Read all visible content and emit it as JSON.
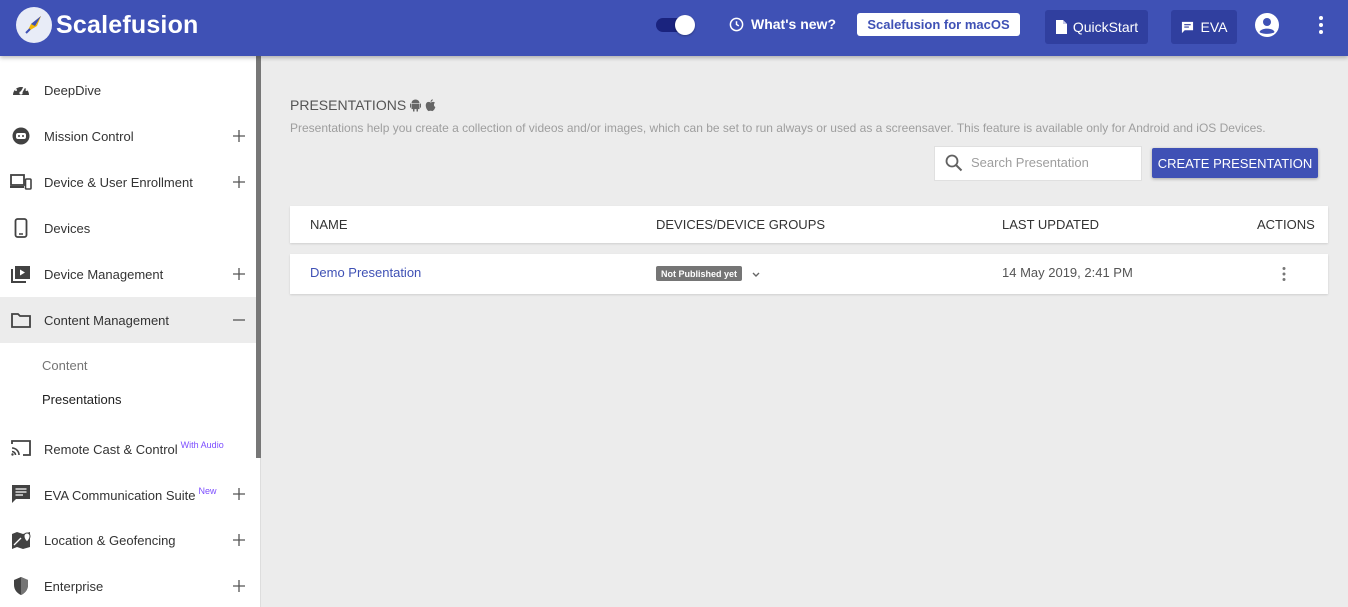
{
  "header": {
    "brand": "Scalefusion",
    "whats_new": "What's new?",
    "mac_button": "Scalefusion for macOS",
    "quickstart": "QuickStart",
    "eva": "EVA",
    "icons": [
      "rocket-logo",
      "toggle-switch",
      "clock-icon",
      "document-icon",
      "chat-icon",
      "account-circle-icon",
      "more-vert-icon"
    ]
  },
  "sidebar": {
    "items": [
      {
        "label": "DeepDive",
        "icon": "speedometer-icon",
        "expandable": false
      },
      {
        "label": "Mission Control",
        "icon": "robot-icon",
        "expandable": true
      },
      {
        "label": "Device & User Enrollment",
        "icon": "devices-icon",
        "expandable": true
      },
      {
        "label": "Devices",
        "icon": "smartphone-icon",
        "expandable": false
      },
      {
        "label": "Device Management",
        "icon": "video-library-icon",
        "expandable": true
      },
      {
        "label": "Content Management",
        "icon": "folder-icon",
        "expandable": true,
        "expanded": true
      },
      {
        "label": "Remote Cast & Control",
        "icon": "cast-icon",
        "expandable": false,
        "tag": "With Audio"
      },
      {
        "label": "EVA Communication Suite",
        "icon": "message-icon",
        "expandable": true,
        "tag": "New"
      },
      {
        "label": "Location & Geofencing",
        "icon": "map-pin-icon",
        "expandable": true
      },
      {
        "label": "Enterprise",
        "icon": "shield-icon",
        "expandable": true
      }
    ],
    "subitems": [
      {
        "label": "Content",
        "active": false
      },
      {
        "label": "Presentations",
        "active": true
      }
    ]
  },
  "main": {
    "title": "PRESENTATIONS",
    "description": "Presentations help you create a collection of videos and/or images, which can be set to run always or used as a screensaver. This feature is available only for Android and iOS Devices.",
    "search_placeholder": "Search Presentation",
    "create_button": "CREATE PRESENTATION",
    "table": {
      "columns": [
        "NAME",
        "DEVICES/DEVICE GROUPS",
        "LAST UPDATED",
        "ACTIONS"
      ],
      "rows": [
        {
          "name": "Demo Presentation",
          "status": "Not Published yet",
          "last_updated": "14 May 2019, 2:41 PM"
        }
      ]
    }
  },
  "colors": {
    "primary": "#3f51b5",
    "primary_dark": "#303f9f",
    "background": "#ececec",
    "accent_tag": "#7c4dff"
  }
}
